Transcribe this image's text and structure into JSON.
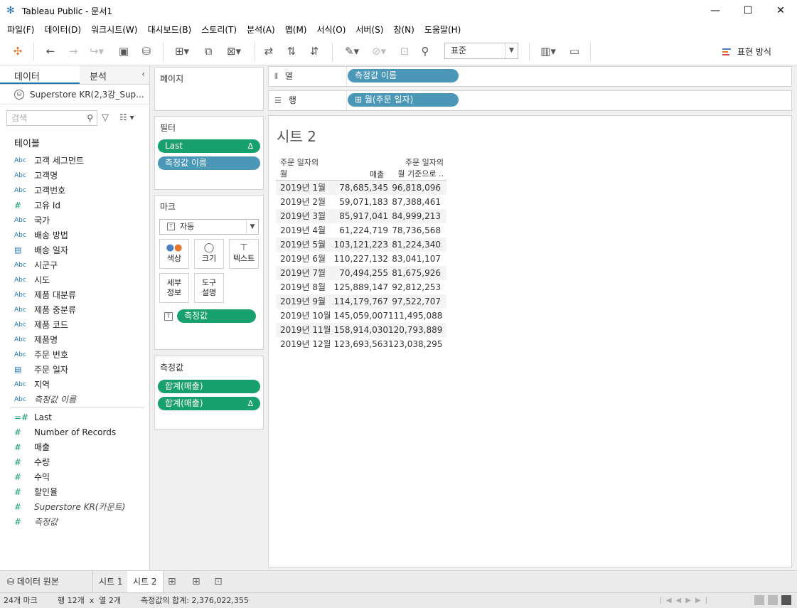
{
  "window": {
    "title": "Tableau Public - 문서1",
    "minimize": "—",
    "maximize": "☐",
    "close": "✕"
  },
  "menu": [
    "파일(F)",
    "데이터(D)",
    "워크시트(W)",
    "대시보드(B)",
    "스토리(T)",
    "분석(A)",
    "맵(M)",
    "서식(O)",
    "서버(S)",
    "창(N)",
    "도움말(H)"
  ],
  "toolbar": {
    "fit_select": "표준",
    "show_me": "표현 방식"
  },
  "data_pane": {
    "tab_data": "데이터",
    "tab_analysis": "분석",
    "datasource": "Superstore KR(2,3강_Sup...",
    "search_placeholder": "검색",
    "tables_header": "테이블",
    "fields": [
      {
        "type": "Abc",
        "name": "고객 세그먼트"
      },
      {
        "type": "Abc",
        "name": "고객명"
      },
      {
        "type": "Abc",
        "name": "고객번호"
      },
      {
        "type": "#",
        "name": "고유 Id"
      },
      {
        "type": "Abc",
        "name": "국가"
      },
      {
        "type": "Abc",
        "name": "배송 방법"
      },
      {
        "type": "cal",
        "name": "배송 일자"
      },
      {
        "type": "Abc",
        "name": "시군구"
      },
      {
        "type": "Abc",
        "name": "시도"
      },
      {
        "type": "Abc",
        "name": "제품 대분류"
      },
      {
        "type": "Abc",
        "name": "제품 중분류"
      },
      {
        "type": "Abc",
        "name": "제품 코드"
      },
      {
        "type": "Abc",
        "name": "제품명"
      },
      {
        "type": "Abc",
        "name": "주문 번호"
      },
      {
        "type": "cal",
        "name": "주문 일자"
      },
      {
        "type": "Abc",
        "name": "지역"
      },
      {
        "type": "Abc",
        "name": "측정값 이름"
      }
    ],
    "measures": [
      {
        "type": "=#",
        "name": "Last"
      },
      {
        "type": "#",
        "name": "Number of Records"
      },
      {
        "type": "#",
        "name": "매출"
      },
      {
        "type": "#",
        "name": "수량"
      },
      {
        "type": "#",
        "name": "수익"
      },
      {
        "type": "#",
        "name": "할인율"
      },
      {
        "type": "#",
        "name": "Superstore KR(카운트)"
      },
      {
        "type": "#",
        "name": "측정값"
      }
    ]
  },
  "cards": {
    "pages": "페이지",
    "filters": "필터",
    "filter_pills": [
      "Last",
      "측정값 이름"
    ],
    "marks": "마크",
    "marks_type": "자동",
    "mark_buttons": [
      "색상",
      "크기",
      "텍스트",
      "세부\n정보",
      "도구\n설명"
    ],
    "marks_pill": "측정값",
    "measure_values": "측정값",
    "measure_pills": [
      "합계(매출)",
      "합계(매출)"
    ],
    "delta": "Δ"
  },
  "shelves": {
    "columns_label": "열",
    "columns_pill": "측정값 이름",
    "rows_label": "행",
    "rows_pill": "⊞ 월(주문 일자)"
  },
  "view": {
    "sheet_title": "시트 2",
    "col1_header": "주문 일자의\n월",
    "col2_header": "매출",
    "col3_header": "주문 일자의\n월 기준으로 ..",
    "rows": [
      [
        "2019년 1월",
        "78,685,345",
        "96,818,096"
      ],
      [
        "2019년 2월",
        "59,071,183",
        "87,388,461"
      ],
      [
        "2019년 3월",
        "85,917,041",
        "84,999,213"
      ],
      [
        "2019년 4월",
        "61,224,719",
        "78,736,568"
      ],
      [
        "2019년 5월",
        "103,121,223",
        "81,224,340"
      ],
      [
        "2019년 6월",
        "110,227,132",
        "83,041,107"
      ],
      [
        "2019년 7월",
        "70,494,255",
        "81,675,926"
      ],
      [
        "2019년 8월",
        "125,889,147",
        "92,812,253"
      ],
      [
        "2019년 9월",
        "114,179,767",
        "97,522,707"
      ],
      [
        "2019년 10월",
        "145,059,007",
        "111,495,088"
      ],
      [
        "2019년 11월",
        "158,914,030",
        "120,793,889"
      ],
      [
        "2019년 12월",
        "123,693,563",
        "123,038,295"
      ]
    ]
  },
  "tabs": {
    "datasource": "데이터 원본",
    "sheet1": "시트 1",
    "sheet2": "시트 2"
  },
  "status": {
    "marks": "24개 마크",
    "rows_cols": "행 12개  x  열 2개",
    "sum": "측정값의 합계: 2,376,022,355"
  },
  "colors": {
    "green_pill": "#18a06f",
    "blue_pill": "#4a97b7",
    "accent": "#1f77b4"
  }
}
